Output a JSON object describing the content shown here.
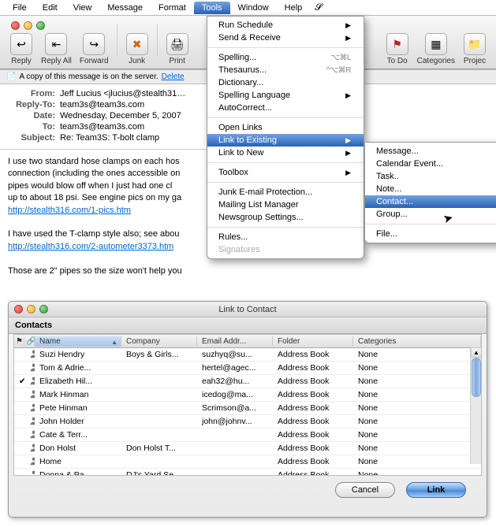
{
  "menubar": {
    "items": [
      "File",
      "Edit",
      "View",
      "Message",
      "Format",
      "Tools",
      "Window",
      "Help"
    ],
    "active_index": 5
  },
  "toolbar": {
    "reply": "Reply",
    "reply_all": "Reply All",
    "forward": "Forward",
    "junk": "Junk",
    "print": "Print",
    "todo": "To Do",
    "categories": "Categories",
    "projects": "Projec"
  },
  "server_bar": {
    "text": "A copy of this message is on the server.",
    "delete_link": "Delete"
  },
  "headers": {
    "from_label": "From:",
    "from_value": "Jeff Lucius <jlucius@stealth31…",
    "replyto_label": "Reply-To:",
    "replyto_value": "team3s@team3s.com",
    "date_label": "Date:",
    "date_value": "Wednesday, December 5, 2007",
    "to_label": "To:",
    "to_value": "team3s@team3s.com",
    "subject_label": "Subject:",
    "subject_value": "Re: Team3S: T-bolt clamp"
  },
  "body": {
    "p1a": "I use two standard hose clamps on each hos",
    "p1b": "connection (including the ones accessible on",
    "p1c": "pipes would blow off when I just had one cl",
    "p1d": "up to about 18 psi. See engine pics on my ga",
    "link1": "http://stealth316.com/1-pics.htm",
    "p2a": "I have used the T-clamp style also; see abou",
    "link2": "http://stealth316.com/2-autometer3373.htm",
    "p3": "Those are 2\" pipes so the size won't help you"
  },
  "tools_menu": {
    "run_schedule": "Run Schedule",
    "send_receive": "Send & Receive",
    "spelling": "Spelling...",
    "spelling_sc": "⌥⌘L",
    "thesaurus": "Thesaurus...",
    "thesaurus_sc": "^⌥⌘R",
    "dictionary": "Dictionary...",
    "spelling_lang": "Spelling Language",
    "autocorrect": "AutoCorrect...",
    "open_links": "Open Links",
    "link_existing": "Link to Existing",
    "link_new": "Link to New",
    "toolbox": "Toolbox",
    "junk_protect": "Junk E-mail Protection...",
    "mailing_list": "Mailing List Manager",
    "newsgroup": "Newsgroup Settings...",
    "rules": "Rules...",
    "signatures": "Signatures"
  },
  "submenu": {
    "message": "Message...",
    "calendar": "Calendar Event...",
    "task": "Task..",
    "note": "Note...",
    "contact": "Contact...",
    "group": "Group...",
    "file": "File..."
  },
  "contacts_window": {
    "title": "Link to Contact",
    "section": "Contacts",
    "columns": {
      "flag": "⚑",
      "link": "🔗",
      "name": "Name",
      "company": "Company",
      "email": "Email Addr...",
      "folder": "Folder",
      "categories": "Categories"
    },
    "rows": [
      {
        "flag": "",
        "link": "",
        "name": "Suzi Hendry",
        "company": "Boys & Girls...",
        "email": "suzhyq@su...",
        "folder": "Address Book",
        "cat": "None"
      },
      {
        "flag": "",
        "link": "",
        "name": "Tom & Adrie...",
        "company": "",
        "email": "hertel@agec...",
        "folder": "Address Book",
        "cat": "None"
      },
      {
        "flag": "✔",
        "link": "",
        "name": "Elizabeth Hil...",
        "company": "",
        "email": "eah32@hu...",
        "folder": "Address Book",
        "cat": "None"
      },
      {
        "flag": "",
        "link": "",
        "name": "Mark Hinman",
        "company": "",
        "email": "icedog@ma...",
        "folder": "Address Book",
        "cat": "None"
      },
      {
        "flag": "",
        "link": "",
        "name": "Pete Hinman",
        "company": "",
        "email": "Scrimson@a...",
        "folder": "Address Book",
        "cat": "None"
      },
      {
        "flag": "",
        "link": "",
        "name": "John Holder",
        "company": "",
        "email": "john@johnv...",
        "folder": "Address Book",
        "cat": "None"
      },
      {
        "flag": "",
        "link": "",
        "name": "Cate & Terr...",
        "company": "",
        "email": "",
        "folder": "Address Book",
        "cat": "None"
      },
      {
        "flag": "",
        "link": "",
        "name": "Don Holst",
        "company": "Don Holst T...",
        "email": "",
        "folder": "Address Book",
        "cat": "None"
      },
      {
        "flag": "",
        "link": "",
        "name": "Home",
        "company": "",
        "email": "",
        "folder": "Address Book",
        "cat": "None"
      },
      {
        "flag": "",
        "link": "",
        "name": "Donna & Pa",
        "company": "DJ's Yard Se",
        "email": "",
        "folder": "Address Book",
        "cat": "None"
      }
    ],
    "cancel": "Cancel",
    "link_btn": "Link"
  }
}
